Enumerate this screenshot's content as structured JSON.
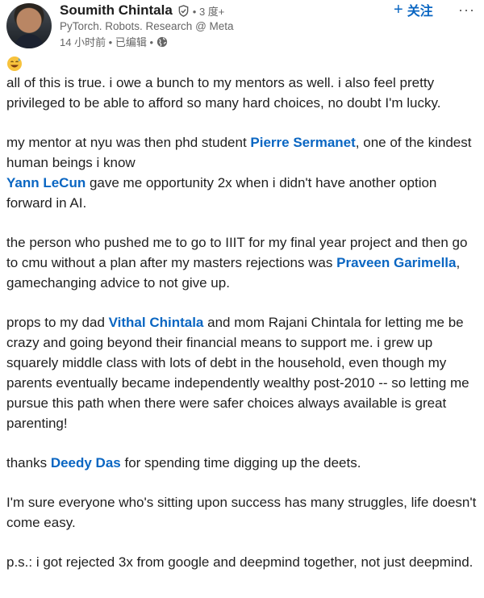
{
  "author": {
    "name": "Soumith Chintala",
    "degree": "• 3 度+",
    "headline": "PyTorch. Robots. Research @ Meta",
    "time": "14 小时前 • 已编辑 •"
  },
  "header": {
    "follow_label": "关注",
    "more_label": "···"
  },
  "post": {
    "emoji": "😅",
    "p1": "all of this is true. i owe a bunch to my mentors as well. i also feel pretty privileged to be able to afford so many hard choices, no doubt I'm lucky.",
    "p2_a": "my mentor at nyu was then phd student ",
    "p2_mention_1": "Pierre Sermanet",
    "p2_b": ", one of the kindest human beings i know",
    "p2_mention_2": "Yann LeCun",
    "p2_c": " gave me opportunity 2x when i didn't have another option forward in AI.",
    "p3_a": "the person who pushed me to go to IIIT for my final year project and then go to cmu without a plan after my masters rejections was ",
    "p3_mention": "Praveen Garimella",
    "p3_b": ", gamechanging advice to not give up.",
    "p4_a": "props to my dad ",
    "p4_mention": "Vithal Chintala",
    "p4_b": " and mom Rajani Chintala for letting me be crazy and going beyond their financial means to support me. i grew up squarely middle class with lots of debt in the household, even though my parents eventually became independently wealthy post-2010 -- so letting me pursue this path when there were safer choices always available is great parenting!",
    "p5_a": "thanks ",
    "p5_mention": "Deedy Das",
    "p5_b": " for spending time digging up the deets.",
    "p6": "I'm sure everyone who's sitting upon success has many struggles, life doesn't come easy.",
    "p7": "p.s.: i got rejected 3x from google and deepmind together, not just deepmind."
  },
  "icons": {
    "verified": "verified-icon",
    "globe": "globe-icon",
    "plus": "plus-icon",
    "emoji": "sweat-smile-emoji"
  },
  "colors": {
    "link": "#0a66c2",
    "text": "#1f1f1f",
    "muted": "#666666"
  }
}
